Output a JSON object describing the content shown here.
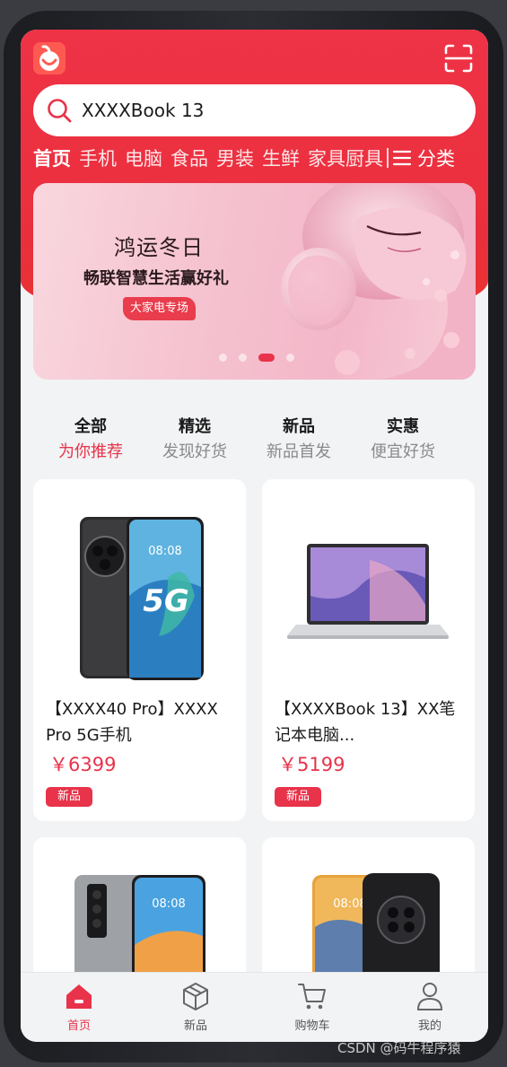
{
  "header": {
    "search_text": "XXXXBook 13",
    "categories": [
      "首页",
      "手机",
      "电脑",
      "食品",
      "男装",
      "生鲜",
      "家具厨具"
    ],
    "category_all": "分类"
  },
  "banner": {
    "title": "鸿运冬日",
    "subtitle": "畅联智慧生活赢好礼",
    "tag": "大家电专场"
  },
  "tabs": [
    {
      "title": "全部",
      "subtitle": "为你推荐"
    },
    {
      "title": "精选",
      "subtitle": "发现好货"
    },
    {
      "title": "新品",
      "subtitle": "新品首发"
    },
    {
      "title": "实惠",
      "subtitle": "便宜好货"
    }
  ],
  "products": [
    {
      "name": "【XXXX40 Pro】XXXX Pro 5G手机",
      "price": "￥6399",
      "badge": "新品",
      "phone_time": "08:08",
      "phone_mark": "5G"
    },
    {
      "name": "【XXXXBook 13】XX笔记本电脑...",
      "price": "￥5199",
      "badge": "新品"
    },
    {
      "name": "",
      "price": "",
      "badge": "",
      "phone_time": "08:08"
    },
    {
      "name": "",
      "price": "",
      "badge": "",
      "phone_time": "08:08"
    }
  ],
  "bottom_nav": [
    {
      "label": "首页",
      "icon": "home-icon"
    },
    {
      "label": "新品",
      "icon": "box-icon"
    },
    {
      "label": "购物车",
      "icon": "cart-icon"
    },
    {
      "label": "我的",
      "icon": "user-icon"
    }
  ],
  "watermark": "CSDN @码牛程序猿",
  "colors": {
    "accent": "#e8334a",
    "header": "#ef3347"
  }
}
